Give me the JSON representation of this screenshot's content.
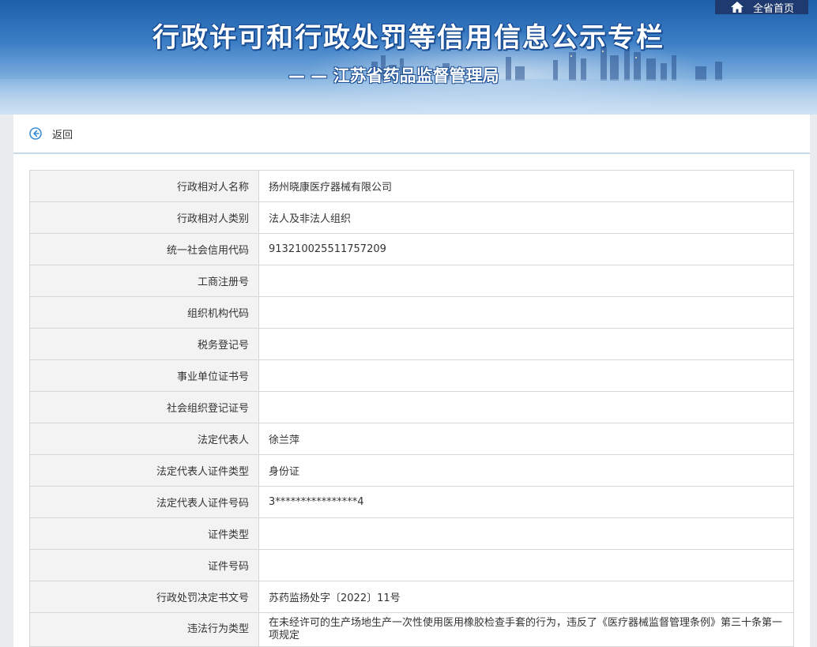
{
  "banner": {
    "title": "行政许可和行政处罚等信用信息公示专栏",
    "subtitle": "— — 江苏省药品监督管理局"
  },
  "nav": {
    "home_label": "全省首页",
    "home_icon": "home-icon"
  },
  "toolbar": {
    "back_label": "返回",
    "back_icon": "back-arrow-icon"
  },
  "record": [
    {
      "label": "行政相对人名称",
      "value": "扬州晓康医疗器械有限公司"
    },
    {
      "label": "行政相对人类别",
      "value": "法人及非法人组织"
    },
    {
      "label": "统一社会信用代码",
      "value": "913210025511757209"
    },
    {
      "label": "工商注册号",
      "value": ""
    },
    {
      "label": "组织机构代码",
      "value": ""
    },
    {
      "label": "税务登记号",
      "value": ""
    },
    {
      "label": "事业单位证书号",
      "value": ""
    },
    {
      "label": "社会组织登记证号",
      "value": ""
    },
    {
      "label": "法定代表人",
      "value": "徐兰萍"
    },
    {
      "label": "法定代表人证件类型",
      "value": "身份证"
    },
    {
      "label": "法定代表人证件号码",
      "value": "3****************4"
    },
    {
      "label": "证件类型",
      "value": ""
    },
    {
      "label": "证件号码",
      "value": ""
    },
    {
      "label": "行政处罚决定书文号",
      "value": "苏药监扬处字〔2022〕11号"
    },
    {
      "label": "违法行为类型",
      "value": "在未经许可的生产场地生产一次性使用医用橡胶检查手套的行为，违反了《医疗器械监督管理条例》第三十条第一项规定"
    }
  ],
  "colors": {
    "banner_dark": "#1d5fa8",
    "nav_bg": "#1e3a6e",
    "label_bg": "#f3f3f3",
    "accent": "#3b8fd6"
  }
}
